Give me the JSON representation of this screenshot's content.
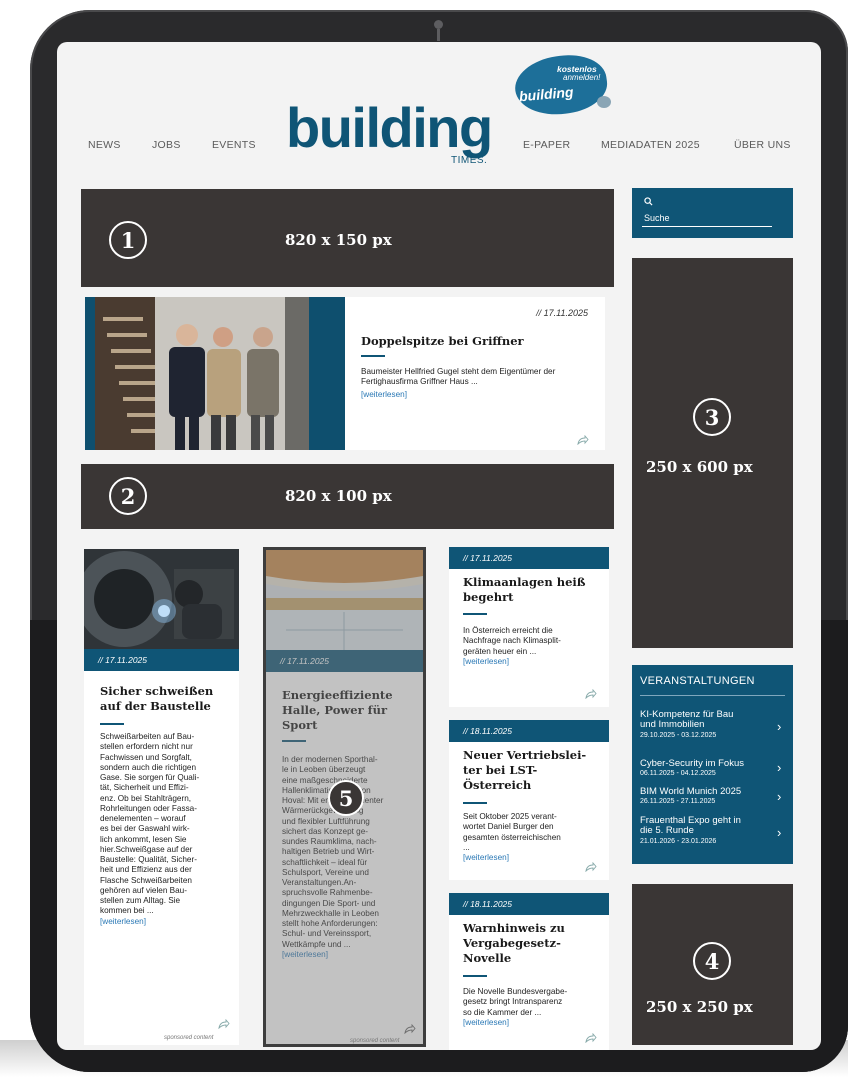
{
  "colors": {
    "brand": "#0f5576",
    "ad_fill": "#3a3635",
    "link": "#2a78b5"
  },
  "header": {
    "nav_left": [
      "NEWS",
      "JOBS",
      "EVENTS"
    ],
    "nav_right": [
      "E-PAPER",
      "MEDIADATEN 2025",
      "ÜBER UNS"
    ],
    "logo": "building",
    "logo_sub": "TIMES.",
    "badge": {
      "line1": "kostenlos",
      "line2": "anmelden!",
      "brand": "building"
    }
  },
  "search": {
    "placeholder": "Suche",
    "icon": "search-icon"
  },
  "ads": [
    {
      "number": "1",
      "size": "820 x 150 px"
    },
    {
      "number": "2",
      "size": "820 x 100 px"
    },
    {
      "number": "3",
      "size": "250 x 600 px"
    },
    {
      "number": "4",
      "size": "250 x 250 px"
    },
    {
      "number": "5"
    }
  ],
  "featured": {
    "date": "// 17.11.2025",
    "title": "Doppelspitze bei Griffner",
    "teaser": "Baumeister Hellfried Gugel steht dem Eigentümer der Fertighausfirma Griffner Haus ...",
    "more": "[weiterlesen]"
  },
  "articles": [
    {
      "date": "// 17.11.2025",
      "title_lines": [
        "Sicher schweißen",
        "auf der Baustelle"
      ],
      "body_lines": [
        "Schweißarbeiten auf Bau-",
        "stellen erfordern nicht nur",
        "Fachwissen und Sorgfalt,",
        "sondern auch die richtigen",
        "Gase. Sie sorgen für Quali-",
        "tät, Sicherheit und Effizi-",
        "enz. Ob bei Stahlträgern,",
        "Rohrleitungen oder Fassa-",
        "denelementen – worauf",
        "es bei der Gaswahl wirk-",
        "lich ankommt, lesen Sie",
        "hier.Schweißgase auf der",
        "Baustelle: Qualität, Sicher-",
        "heit und Effizienz aus der",
        "Flasche Schweißarbeiten",
        "gehören auf vielen Bau-",
        "stellen zum Alltag. Sie",
        "kommen bei ..."
      ],
      "more": "[weiterlesen]",
      "sponsored": "sponsored content"
    },
    {
      "date": "// 17.11.2025",
      "title_lines": [
        "Energieeffiziente",
        "Halle, Power für",
        "Sport"
      ],
      "body_lines": [
        "In der modernen Sporthal-",
        "le in Leoben überzeugt",
        "eine maßgeschneiderte",
        "Hallenklimatisierung von",
        "Hoval: Mit energieeffizienter",
        "Wärmerückgewinnung",
        "und flexibler Luftführung",
        "sichert das Konzept ge-",
        "sundes Raumklima, nach-",
        "haltigen Betrieb und Wirt-",
        "schaftlichkeit – ideal für",
        "Schulsport, Vereine und",
        "Veranstaltungen.An-",
        "spruchsvolle Rahmenbe-",
        "dingungen Die Sport- und",
        "Mehrzweckhalle in Leoben",
        "stellt hohe Anforderungen:",
        "Schul- und Vereinssport,",
        "Wettkämpfe und ..."
      ],
      "more": "[weiterlesen]",
      "sponsored": "sponsored content"
    },
    {
      "date": "// 17.11.2025",
      "title_lines": [
        "Klimaanlagen heiß",
        "begehrt"
      ],
      "body_lines": [
        "In Österreich erreicht die",
        "Nachfrage nach Klimasplit-",
        "geräten heuer ein ..."
      ],
      "more": "[weiterlesen]"
    },
    {
      "date": "// 18.11.2025",
      "title_lines": [
        "Neuer Vertriebslei-",
        "ter bei LST-",
        "Österreich"
      ],
      "body_lines": [
        "Seit Oktober 2025 verant-",
        "wortet Daniel Burger den",
        "gesamten österreichischen",
        "..."
      ],
      "more": "[weiterlesen]"
    },
    {
      "date": "// 18.11.2025",
      "title_lines": [
        "Warnhinweis zu",
        "Vergabegesetz-",
        "Novelle"
      ],
      "body_lines": [
        "Die Novelle Bundesvergabe-",
        "gesetz bringt Intransparenz",
        "so die Kammer der ..."
      ],
      "more": "[weiterlesen]"
    }
  ],
  "events": {
    "title": "VERANSTALTUNGEN",
    "items": [
      {
        "title_lines": [
          "KI-Kompetenz für Bau",
          "und Immobilien"
        ],
        "dates": "29.10.2025 - 03.12.2025"
      },
      {
        "title_lines": [
          "Cyber-Security im Fokus"
        ],
        "dates": "06.11.2025 - 04.12.2025"
      },
      {
        "title_lines": [
          "BIM World Munich 2025"
        ],
        "dates": "26.11.2025 - 27.11.2025"
      },
      {
        "title_lines": [
          "Frauenthal Expo geht in",
          "die 5. Runde"
        ],
        "dates": "21.01.2026 - 23.01.2026"
      }
    ]
  }
}
